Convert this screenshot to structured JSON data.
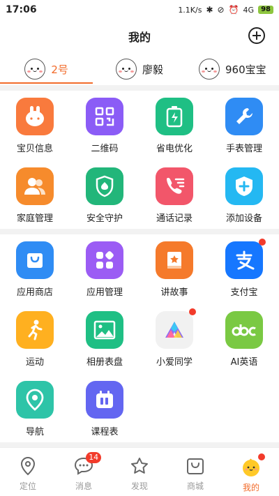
{
  "status": {
    "time": "17:06",
    "speed": "1.1K/s",
    "network": "4G",
    "battery": "98"
  },
  "header": {
    "title": "我的"
  },
  "tabs": [
    {
      "label": "2号",
      "active": true
    },
    {
      "label": "廖毅",
      "active": false
    },
    {
      "label": "960宝宝",
      "active": false
    }
  ],
  "section1": [
    {
      "label": "宝贝信息",
      "icon": "rabbit-face-icon",
      "color": "#f97a3d"
    },
    {
      "label": "二维码",
      "icon": "qr-code-icon",
      "color": "#8b5cf6"
    },
    {
      "label": "省电优化",
      "icon": "battery-icon",
      "color": "#1fbf84"
    },
    {
      "label": "手表管理",
      "icon": "wrench-icon",
      "color": "#2f8cf4"
    },
    {
      "label": "家庭管理",
      "icon": "family-icon",
      "color": "#f68b2c"
    },
    {
      "label": "安全守护",
      "icon": "shield-icon",
      "color": "#22b67a"
    },
    {
      "label": "通话记录",
      "icon": "phone-log-icon",
      "color": "#f2566a"
    },
    {
      "label": "添加设备",
      "icon": "add-device-icon",
      "color": "#24b8f2"
    }
  ],
  "section2": [
    {
      "label": "应用商店",
      "icon": "store-bag-icon",
      "color": "#2f8cf4",
      "dot": false
    },
    {
      "label": "应用管理",
      "icon": "apps-icon",
      "color": "#9b5cf4",
      "dot": false
    },
    {
      "label": "讲故事",
      "icon": "storybook-icon",
      "color": "#f57a2b",
      "dot": false
    },
    {
      "label": "支付宝",
      "icon": "alipay-icon",
      "color": "#1677ff",
      "dot": true
    },
    {
      "label": "运动",
      "icon": "running-icon",
      "color": "#ffb020",
      "dot": false
    },
    {
      "label": "相册表盘",
      "icon": "photo-icon",
      "color": "#1fbf84",
      "dot": false
    },
    {
      "label": "小爱同学",
      "icon": "xiaoai-icon",
      "color": "#f1f1f1",
      "dot": true
    },
    {
      "label": "AI英语",
      "icon": "abc-icon",
      "color": "#7ac943",
      "dot": false
    },
    {
      "label": "导航",
      "icon": "location-pin-icon",
      "color": "#2ec4a8",
      "dot": false
    },
    {
      "label": "课程表",
      "icon": "calendar-icon",
      "color": "#6366f1",
      "dot": false
    }
  ],
  "bottomnav": [
    {
      "label": "定位",
      "icon": "location-icon",
      "active": false
    },
    {
      "label": "消息",
      "icon": "chat-icon",
      "active": false,
      "badge": "14"
    },
    {
      "label": "发现",
      "icon": "star-icon",
      "active": false
    },
    {
      "label": "商城",
      "icon": "shop-bag-icon",
      "active": false
    },
    {
      "label": "我的",
      "icon": "me-avatar-icon",
      "active": true,
      "dot": true
    }
  ],
  "colors": {
    "accent": "#f26b2a",
    "badge": "#f23b2b"
  }
}
